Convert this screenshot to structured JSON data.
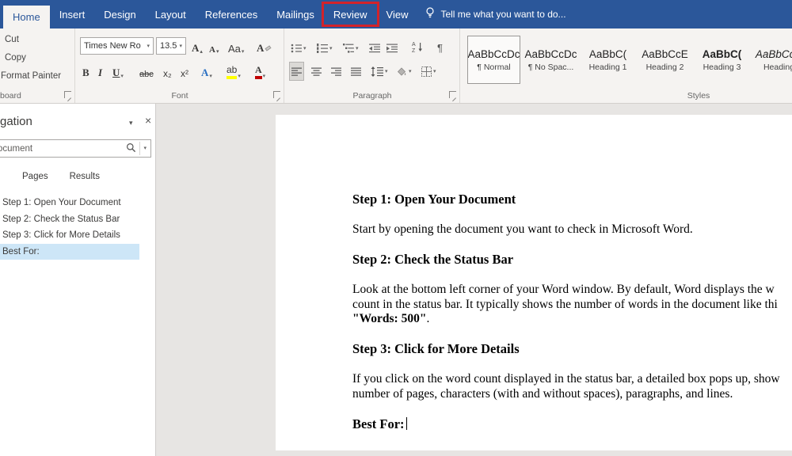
{
  "colors": {
    "titlebar_blue": "#2b579a",
    "ribbon_bg": "#f5f3f1",
    "document_bg": "#e7e5e3",
    "nav_selected_bg": "#cde6f7",
    "annotation_red": "#d2232a",
    "heading_style_blue": "#2e74b5",
    "highlight_yellow": "#ffff00",
    "font_color_red": "#c00000"
  },
  "titlebar": {
    "tabs": [
      {
        "label": "Home",
        "active": true
      },
      {
        "label": "Insert",
        "active": false
      },
      {
        "label": "Design",
        "active": false
      },
      {
        "label": "Layout",
        "active": false
      },
      {
        "label": "References",
        "active": false
      },
      {
        "label": "Mailings",
        "active": false
      },
      {
        "label": "Review",
        "active": false,
        "annotated": true
      },
      {
        "label": "View",
        "active": false
      }
    ],
    "tell_me": "Tell me what you want to do..."
  },
  "ribbon": {
    "clipboard": {
      "cut": "Cut",
      "copy": "Copy",
      "format_painter": "Format Painter",
      "group_label": "board"
    },
    "font": {
      "name": "Times New Ro",
      "size": "13.5",
      "grow": "A",
      "shrink": "A",
      "change_case": "Aa",
      "clear_format": "A",
      "bold": "B",
      "italic": "I",
      "underline": "U",
      "strikethrough": "abc",
      "subscript": "x₂",
      "superscript": "x²",
      "text_effects": "A",
      "highlight": "ab",
      "font_color": "A",
      "group_label": "Font"
    },
    "paragraph": {
      "pilcrow": "¶",
      "group_label": "Paragraph"
    },
    "styles": {
      "group_label": "Styles",
      "items": [
        {
          "preview": "AaBbCcDc",
          "name": "¶ Normal",
          "selected": true
        },
        {
          "preview": "AaBbCcDc",
          "name": "¶ No Spac...",
          "selected": false
        },
        {
          "preview": "AaBbC(",
          "name": "Heading 1",
          "selected": false
        },
        {
          "preview": "AaBbCcE",
          "name": "Heading 2",
          "selected": false
        },
        {
          "preview": "AaBbC(",
          "name": "Heading 3",
          "selected": false
        },
        {
          "preview": "AaBbCcD",
          "name": "Heading",
          "selected": false
        }
      ]
    }
  },
  "navigation": {
    "title": "gation",
    "search_text": "ocument",
    "tabs": [
      {
        "label": "Pages"
      },
      {
        "label": "Results"
      }
    ],
    "items": [
      {
        "label": "Step 1: Open Your Document",
        "selected": false
      },
      {
        "label": "Step 2: Check the Status Bar",
        "selected": false
      },
      {
        "label": "Step 3: Click for More Details",
        "selected": false
      },
      {
        "label": "Best For:",
        "selected": true
      }
    ]
  },
  "document": {
    "h1": "Step 1: Open Your Document",
    "p1": "Start by opening the document you want to check in Microsoft Word.",
    "h2": "Step 2: Check the Status Bar",
    "p2_line1": "Look at the bottom left corner of your Word window. By default, Word displays the w",
    "p2_line2": "count in the status bar. It typically shows the number of words in the document like thi",
    "p2_line3_bold": "\"Words: 500\"",
    "p2_line3_tail": ".",
    "h3": "Step 3: Click for More Details",
    "p3_line1": "If you click on the word count displayed in the status bar, a detailed box pops up, show",
    "p3_line2": "number of pages, characters (with and without spaces), paragraphs, and lines.",
    "h4": "Best For:"
  }
}
